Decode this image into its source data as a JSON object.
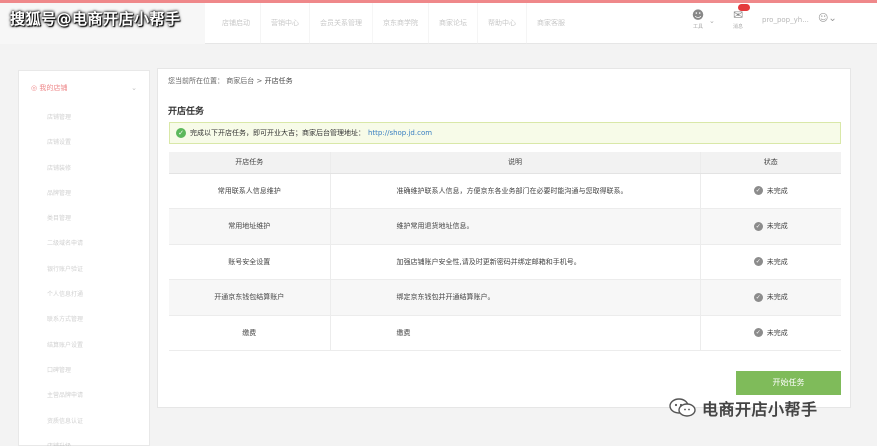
{
  "watermark": {
    "top_text": "搜狐号@电商开店小帮手",
    "bottom_text": "电商开店小帮手"
  },
  "topbar": {
    "nav": [
      "店铺启动",
      "营销中心",
      "会员关系管理",
      "京东商学院",
      "商家论坛",
      "帮助中心",
      "商家客服"
    ],
    "user_name": "pro_pop_yh...",
    "icon1_label": "工具",
    "icon2_label": "消息"
  },
  "sidebar": {
    "header": "我的店铺",
    "items": [
      "店铺管理",
      "店铺设置",
      "店铺装修",
      "品牌管理",
      "类目管理",
      "二级域名申请",
      "银行账户验证",
      "个人信息打通",
      "联系方式管理",
      "结算账户设置",
      "口碑管理",
      "主营品牌申请",
      "资质信息认证",
      "店铺升级"
    ]
  },
  "breadcrumb": {
    "prefix": "您当前所在位置：",
    "level1": "商家后台",
    "sep": ">",
    "current": "开店任务"
  },
  "page": {
    "title": "开店任务",
    "notice_text": "完成以下开店任务，即可开业大吉；商家后台管理地址：",
    "notice_url": "http://shop.jd.com",
    "start_button": "开始任务"
  },
  "table": {
    "headers": [
      "开店任务",
      "说明",
      "状态"
    ],
    "rows": [
      {
        "task": "常用联系人信息维护",
        "desc": "准确维护联系人信息，方便京东各业务部门在必要时能沟通与您取得联系。",
        "status": "未完成"
      },
      {
        "task": "常用地址维护",
        "desc": "维护常用退货地址信息。",
        "status": "未完成"
      },
      {
        "task": "账号安全设置",
        "desc": "加强店铺账户安全性,请及时更新密码并绑定邮箱和手机号。",
        "status": "未完成"
      },
      {
        "task": "开通京东钱包结算账户",
        "desc": "绑定京东钱包并开通结算账户。",
        "status": "未完成"
      },
      {
        "task": "缴费",
        "desc": "缴费",
        "status": "未完成"
      }
    ]
  }
}
